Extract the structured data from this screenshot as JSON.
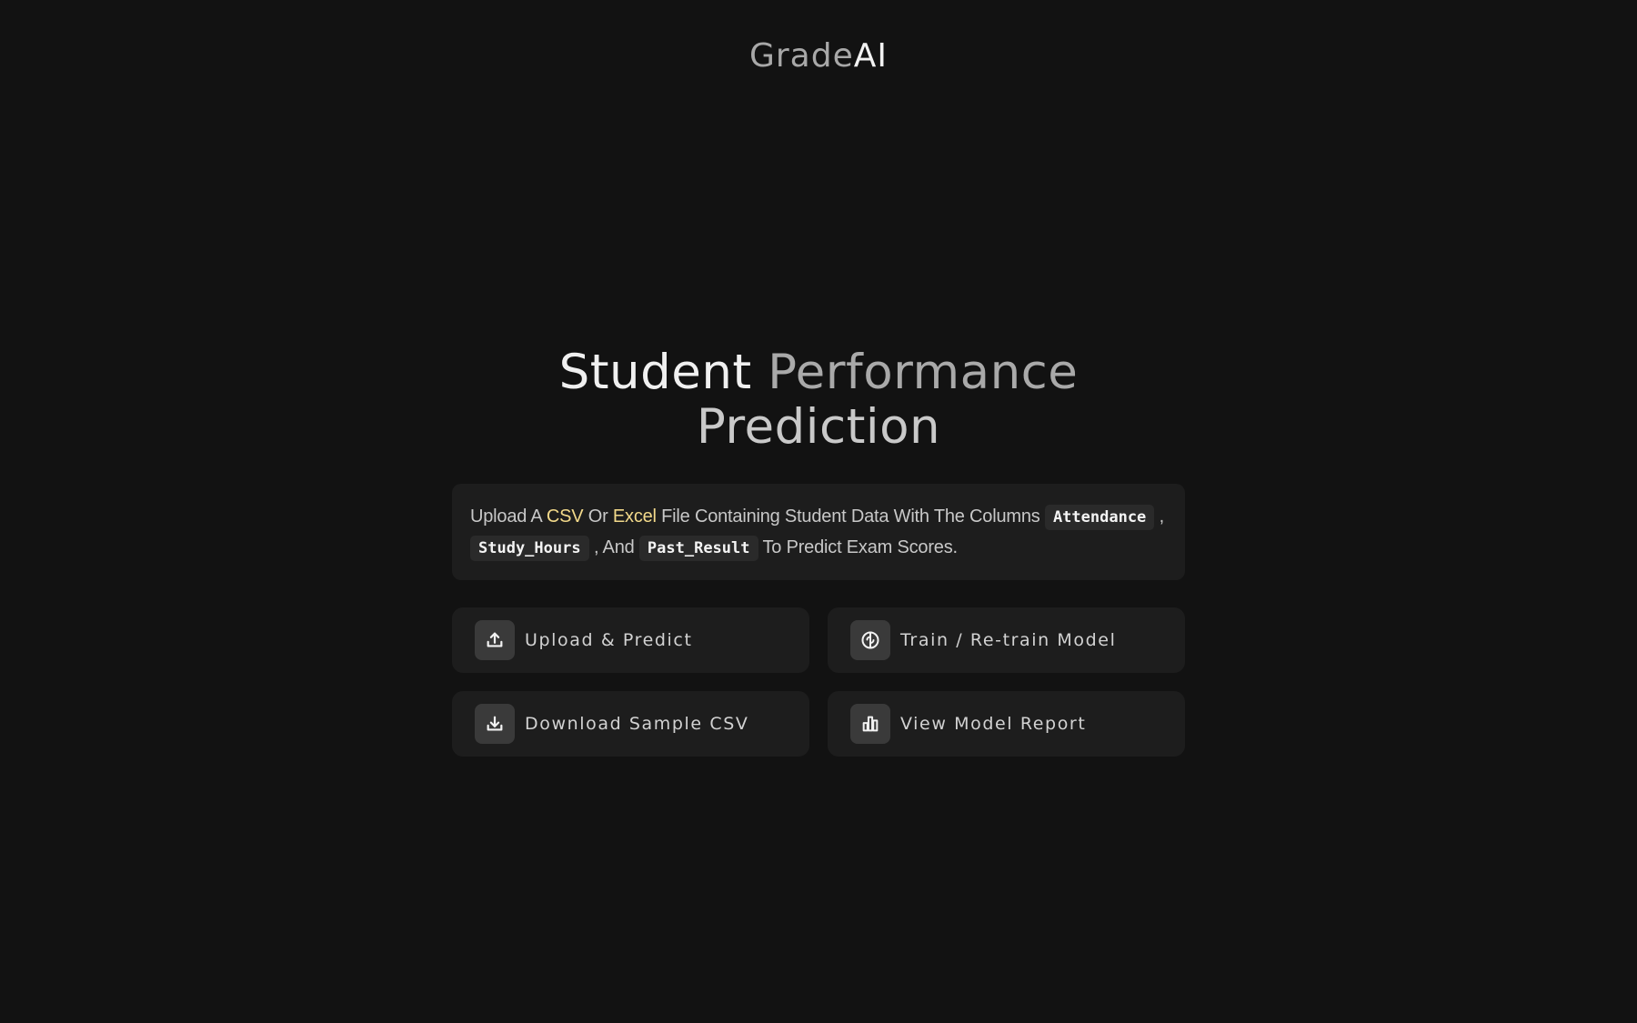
{
  "header": {
    "logo_part1": "Grade",
    "logo_part2": "AI"
  },
  "hero": {
    "title_word1": "Student",
    "title_word2": "Performance",
    "title_word3": "Prediction"
  },
  "info": {
    "text_1": "Upload A ",
    "highlight_csv": "CSV",
    "text_2": " Or ",
    "highlight_excel": "Excel",
    "text_3": " File Containing Student Data With The Columns ",
    "col_1": "Attendance",
    "text_4": " , ",
    "col_2": "Study_Hours",
    "text_5": " , And ",
    "col_3": "Past_Result",
    "text_6": " To Predict Exam Scores."
  },
  "actions": [
    {
      "label": "Upload & Predict",
      "icon": "upload-icon"
    },
    {
      "label": "Train / Re-train Model",
      "icon": "brain-icon"
    },
    {
      "label": "Download Sample CSV",
      "icon": "download-icon"
    },
    {
      "label": "View Model Report",
      "icon": "bar-chart-icon"
    }
  ],
  "colors": {
    "background": "#121212",
    "card": "#1d1d1d",
    "icon_box": "#3a3a3a",
    "highlight": "#f2d98a",
    "text_muted": "#a9a9a9",
    "text_light": "#f0f0f0"
  }
}
